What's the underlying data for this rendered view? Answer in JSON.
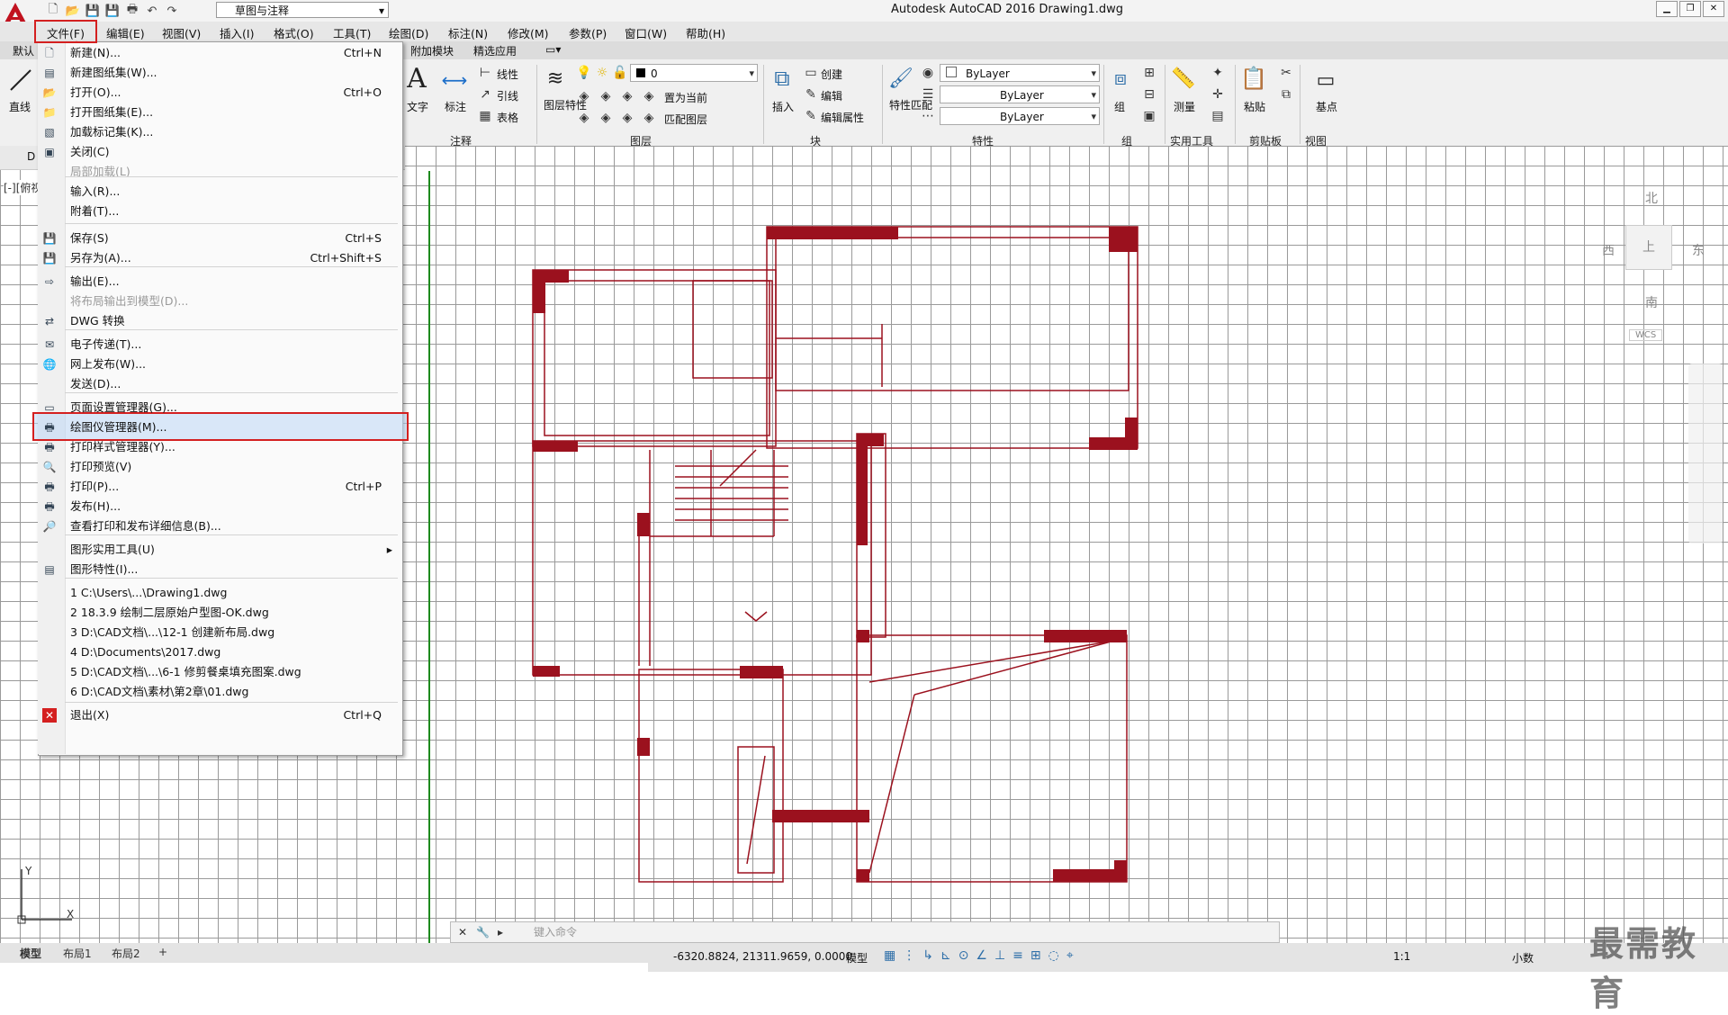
{
  "title": "Autodesk AutoCAD 2016    Drawing1.dwg",
  "workspace": "草图与注释",
  "menubar": [
    "文件(F)",
    "编辑(E)",
    "视图(V)",
    "插入(I)",
    "格式(O)",
    "工具(T)",
    "绘图(D)",
    "标注(N)",
    "修改(M)",
    "参数(P)",
    "窗口(W)",
    "帮助(H)"
  ],
  "ribbon": {
    "tabs": [
      "默认",
      "附加模块",
      "精选应用"
    ],
    "line_label": "直线",
    "text_label": "文字",
    "dim_label": "标注",
    "linear": "线性",
    "leader": "引线",
    "table": "表格",
    "annotation_panel": "注释",
    "layer_props": "图层特性",
    "layer_value": "0",
    "set_current": "置为当前",
    "match_layer": "匹配图层",
    "layers_panel": "图层",
    "insert": "插入",
    "create": "创建",
    "edit": "编辑",
    "edit_attr": "编辑属性",
    "block_panel": "块",
    "match_props": "特性匹配",
    "bylayer1": "ByLayer",
    "bylayer2": "ByLayer",
    "bylayer3": "ByLayer",
    "props_panel": "特性",
    "group": "组",
    "group_panel": "组",
    "measure": "测量",
    "utilities_panel": "实用工具",
    "paste": "粘贴",
    "clipboard_panel": "剪贴板",
    "base": "基点",
    "view_panel": "视图"
  },
  "viewport_label": "[-][俯视]",
  "doc_tab": "D",
  "viewcube": {
    "north": "北",
    "west": "西",
    "east": "东",
    "south": "南",
    "top": "上",
    "wcs": "WCS"
  },
  "file_menu": {
    "items": [
      {
        "label": "新建(N)...",
        "shortcut": "Ctrl+N",
        "icon": "new-icon"
      },
      {
        "label": "新建图纸集(W)...",
        "shortcut": "",
        "icon": "sheetset-icon"
      },
      {
        "label": "打开(O)...",
        "shortcut": "Ctrl+O",
        "icon": "open-icon"
      },
      {
        "label": "打开图纸集(E)...",
        "shortcut": "",
        "icon": "open-sheetset-icon"
      },
      {
        "label": "加载标记集(K)...",
        "shortcut": "",
        "icon": "markup-icon"
      },
      {
        "label": "关闭(C)",
        "shortcut": "",
        "icon": "close-doc-icon"
      },
      {
        "label": "局部加载(L)",
        "shortcut": "",
        "icon": ""
      },
      {
        "label": "输入(R)...",
        "shortcut": "",
        "icon": ""
      },
      {
        "label": "附着(T)...",
        "shortcut": "",
        "icon": ""
      },
      {
        "label": "保存(S)",
        "shortcut": "Ctrl+S",
        "icon": "save-icon"
      },
      {
        "label": "另存为(A)...",
        "shortcut": "Ctrl+Shift+S",
        "icon": "saveas-icon"
      },
      {
        "label": "输出(E)...",
        "shortcut": "",
        "icon": "export-icon"
      },
      {
        "label": "将布局输出到模型(D)...",
        "shortcut": "",
        "icon": ""
      },
      {
        "label": "DWG 转换",
        "shortcut": "",
        "icon": "dwg-convert-icon"
      },
      {
        "label": "电子传递(T)...",
        "shortcut": "",
        "icon": "etransmit-icon"
      },
      {
        "label": "网上发布(W)...",
        "shortcut": "",
        "icon": "publish-web-icon"
      },
      {
        "label": "发送(D)...",
        "shortcut": "",
        "icon": ""
      },
      {
        "label": "页面设置管理器(G)...",
        "shortcut": "",
        "icon": "page-setup-icon"
      },
      {
        "label": "绘图仪管理器(M)...",
        "shortcut": "",
        "icon": "plotter-icon"
      },
      {
        "label": "打印样式管理器(Y)...",
        "shortcut": "",
        "icon": "plotstyle-icon"
      },
      {
        "label": "打印预览(V)",
        "shortcut": "",
        "icon": "preview-icon"
      },
      {
        "label": "打印(P)...",
        "shortcut": "Ctrl+P",
        "icon": "print-icon"
      },
      {
        "label": "发布(H)...",
        "shortcut": "",
        "icon": "publish-icon"
      },
      {
        "label": "查看打印和发布详细信息(B)...",
        "shortcut": "",
        "icon": "details-icon"
      },
      {
        "label": "图形实用工具(U)",
        "shortcut": "",
        "icon": ""
      },
      {
        "label": "图形特性(I)...",
        "shortcut": "",
        "icon": "drawing-props-icon"
      },
      {
        "label": "1 C:\\Users\\...\\Drawing1.dwg",
        "shortcut": "",
        "icon": ""
      },
      {
        "label": "2 18.3.9 绘制二层原始户型图-OK.dwg",
        "shortcut": "",
        "icon": ""
      },
      {
        "label": "3 D:\\CAD文档\\...\\12-1 创建新布局.dwg",
        "shortcut": "",
        "icon": ""
      },
      {
        "label": "4 D:\\Documents\\2017.dwg",
        "shortcut": "",
        "icon": ""
      },
      {
        "label": "5 D:\\CAD文档\\...\\6-1 修剪餐桌填充图案.dwg",
        "shortcut": "",
        "icon": ""
      },
      {
        "label": "6 D:\\CAD文档\\素材\\第2章\\01.dwg",
        "shortcut": "",
        "icon": ""
      },
      {
        "label": "退出(X)",
        "shortcut": "Ctrl+Q",
        "icon": "exit-icon"
      }
    ]
  },
  "command_placeholder": "键入命令",
  "layout_tabs": [
    "模型",
    "布局1",
    "布局2",
    "+"
  ],
  "status": {
    "coords": "-6320.8824, 21311.9659, 0.0000",
    "model": "模型",
    "scale": "1:1",
    "units": "小数"
  },
  "watermark": "最需教育",
  "colors": {
    "wall": "#9b111e",
    "highlight": "#d42020",
    "grid": "#9a9a9a"
  }
}
